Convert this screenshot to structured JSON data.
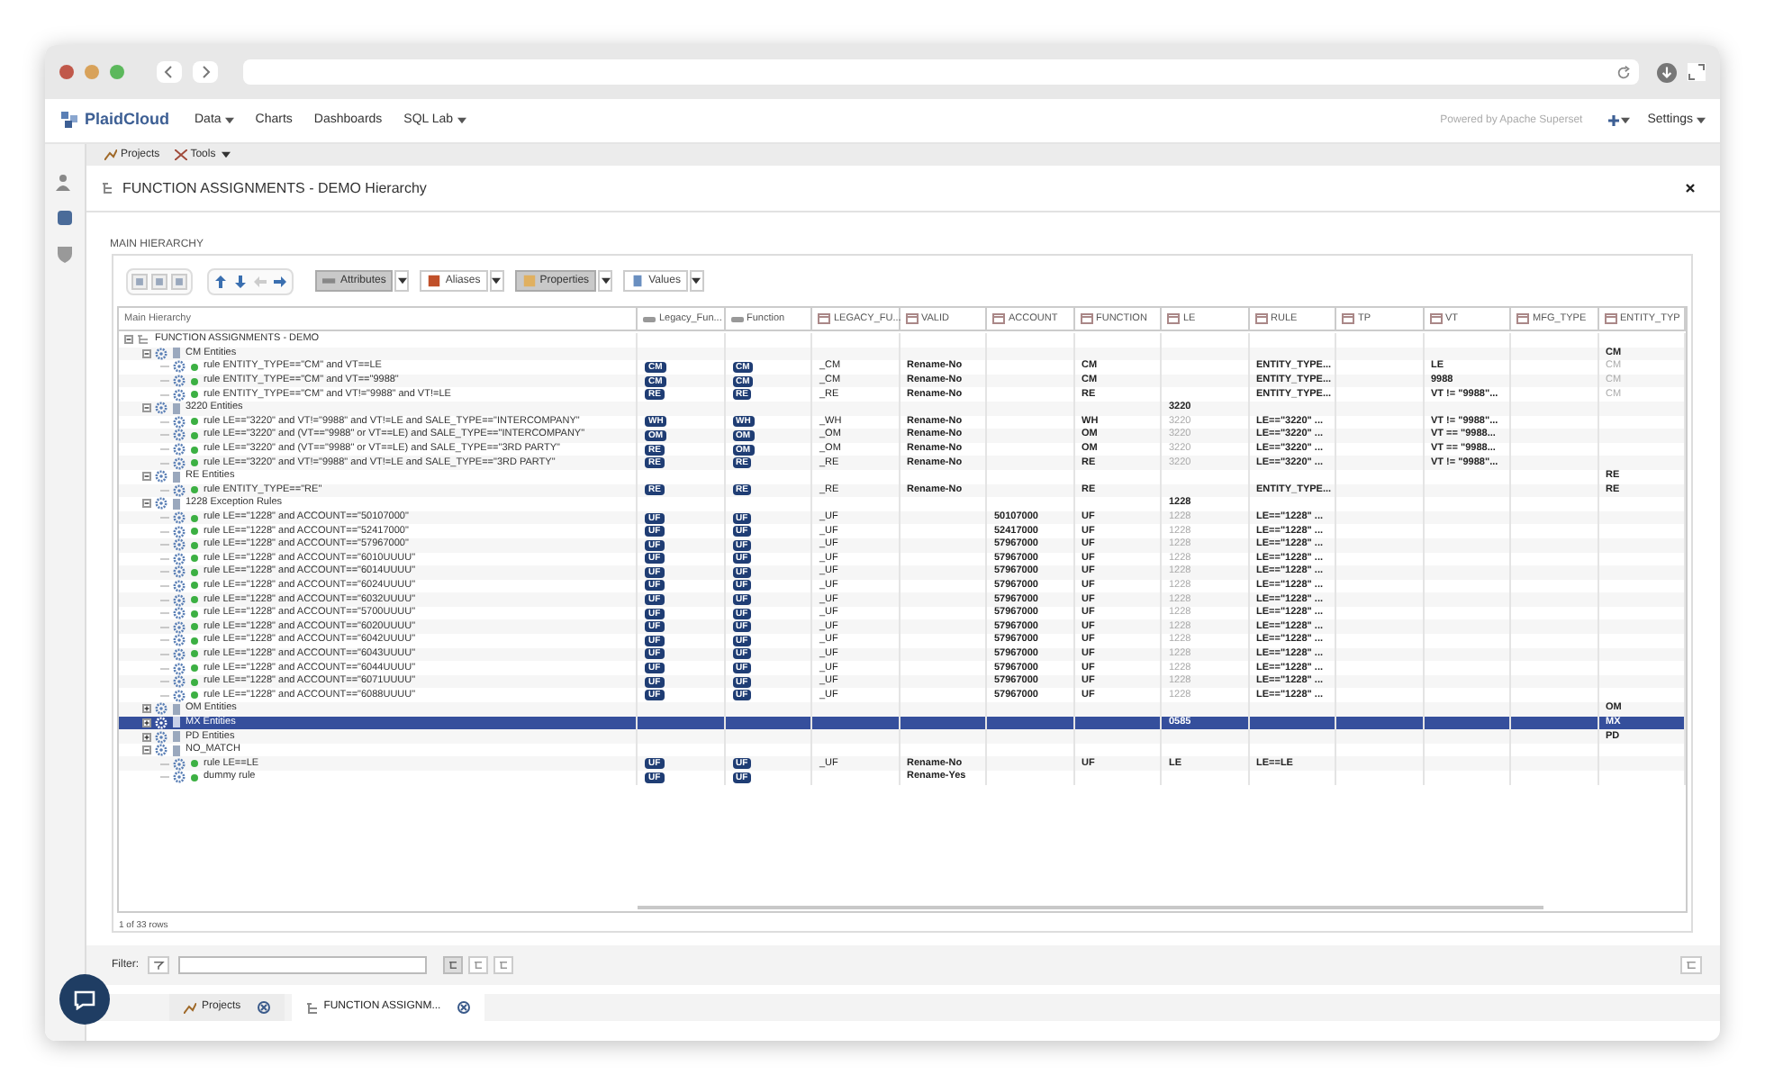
{
  "navbar": {
    "brand": "PlaidCloud",
    "menu": [
      {
        "label": "Data",
        "dropdown": true
      },
      {
        "label": "Charts",
        "dropdown": false
      },
      {
        "label": "Dashboards",
        "dropdown": false
      },
      {
        "label": "SQL Lab",
        "dropdown": true
      }
    ],
    "powered_by": "Powered by Apache Superset",
    "settings": "Settings"
  },
  "subtoolbar": [
    {
      "label": "Projects",
      "dropdown": false
    },
    {
      "label": "Tools",
      "dropdown": true
    }
  ],
  "panel": {
    "title": "FUNCTION ASSIGNMENTS - DEMO Hierarchy",
    "section": "MAIN HIERARCHY"
  },
  "toolbar": {
    "nav_buttons": [
      {
        "kind": "up",
        "disabled": false
      },
      {
        "kind": "down",
        "disabled": false
      },
      {
        "kind": "left",
        "disabled": true
      },
      {
        "kind": "right",
        "disabled": false
      }
    ],
    "view_buttons": [
      {
        "label": "Attributes",
        "selected": true
      },
      {
        "label": "Aliases",
        "selected": false
      },
      {
        "label": "Properties",
        "selected": true
      },
      {
        "label": "Values",
        "selected": false
      }
    ]
  },
  "table": {
    "tree_column": "Main Hierarchy",
    "columns": [
      {
        "label": "Legacy_Fun...",
        "kind": "badge"
      },
      {
        "label": "Function",
        "kind": "badge"
      },
      {
        "label": "LEGACY_FU...",
        "kind": "plain"
      },
      {
        "label": "VALID",
        "kind": "bold"
      },
      {
        "label": "ACCOUNT",
        "kind": "bold"
      },
      {
        "label": "FUNCTION",
        "kind": "bold"
      },
      {
        "label": "LE",
        "kind": "bold"
      },
      {
        "label": "RULE",
        "kind": "bold"
      },
      {
        "label": "TP",
        "kind": "bold"
      },
      {
        "label": "VT",
        "kind": "bold"
      },
      {
        "label": "MFG_TYPE",
        "kind": "bold"
      },
      {
        "label": "ENTITY_TYP",
        "kind": "bold"
      }
    ],
    "rows": [
      {
        "kind": "root",
        "label": "FUNCTION ASSIGNMENTS - DEMO",
        "expanded": true,
        "selected": false,
        "children": [
          {
            "kind": "group",
            "label": "CM Entities",
            "expanded": true,
            "selected": false,
            "cells": [
              null,
              null,
              null,
              null,
              null,
              null,
              null,
              null,
              null,
              null,
              null,
              "CM"
            ],
            "children": [
              {
                "kind": "rule",
                "label": "rule ENTITY_TYPE==\"CM\" and VT==LE",
                "selected": false,
                "cells": [
                  "CM",
                  "CM",
                  "_CM",
                  "Rename-No",
                  null,
                  "CM",
                  null,
                  "ENTITY_TYPE...",
                  null,
                  "LE",
                  null,
                  {
                    "text": "CM",
                    "inherited": true
                  }
                ]
              },
              {
                "kind": "rule",
                "label": "rule ENTITY_TYPE==\"CM\" and VT==\"9988\"",
                "selected": false,
                "cells": [
                  "CM",
                  "CM",
                  "_CM",
                  "Rename-No",
                  null,
                  "CM",
                  null,
                  "ENTITY_TYPE...",
                  null,
                  "9988",
                  null,
                  {
                    "text": "CM",
                    "inherited": true
                  }
                ]
              },
              {
                "kind": "rule",
                "label": "rule ENTITY_TYPE==\"CM\" and VT!=\"9988\" and VT!=LE",
                "selected": false,
                "cells": [
                  "RE",
                  "RE",
                  "_RE",
                  "Rename-No",
                  null,
                  "RE",
                  null,
                  "ENTITY_TYPE...",
                  null,
                  "VT != \"9988\"...",
                  null,
                  {
                    "text": "CM",
                    "inherited": true
                  }
                ]
              }
            ]
          },
          {
            "kind": "group",
            "label": "3220 Entities",
            "expanded": true,
            "selected": false,
            "cells": [
              null,
              null,
              null,
              null,
              null,
              null,
              "3220"
            ],
            "children": [
              {
                "kind": "rule",
                "label": "rule LE==\"3220\" and VT!=\"9988\" and VT!=LE and SALE_TYPE==\"INTERCOMPANY\"",
                "selected": false,
                "cells": [
                  "WH",
                  "WH",
                  "_WH",
                  "Rename-No",
                  null,
                  "WH",
                  {
                    "text": "3220",
                    "inherited": true
                  },
                  "LE==\"3220\" ...",
                  null,
                  "VT != \"9988\"..."
                ]
              },
              {
                "kind": "rule",
                "label": "rule LE==\"3220\" and (VT==\"9988\" or VT==LE) and SALE_TYPE==\"INTERCOMPANY\"",
                "selected": false,
                "cells": [
                  "OM",
                  "OM",
                  "_OM",
                  "Rename-No",
                  null,
                  "OM",
                  {
                    "text": "3220",
                    "inherited": true
                  },
                  "LE==\"3220\" ...",
                  null,
                  "VT == \"9988..."
                ]
              },
              {
                "kind": "rule",
                "label": "rule LE==\"3220\" and (VT==\"9988\" or VT==LE) and SALE_TYPE==\"3RD PARTY\"",
                "selected": false,
                "cells": [
                  "RE",
                  "OM",
                  "_OM",
                  "Rename-No",
                  null,
                  "OM",
                  {
                    "text": "3220",
                    "inherited": true
                  },
                  "LE==\"3220\" ...",
                  null,
                  "VT == \"9988..."
                ]
              },
              {
                "kind": "rule",
                "label": "rule LE==\"3220\" and VT!=\"9988\" and VT!=LE and SALE_TYPE==\"3RD PARTY\"",
                "selected": false,
                "cells": [
                  "RE",
                  "RE",
                  "_RE",
                  "Rename-No",
                  null,
                  "RE",
                  {
                    "text": "3220",
                    "inherited": true
                  },
                  "LE==\"3220\" ...",
                  null,
                  "VT != \"9988\"..."
                ]
              }
            ]
          },
          {
            "kind": "group",
            "label": "RE Entities",
            "expanded": true,
            "selected": false,
            "cells": [
              null,
              null,
              null,
              null,
              null,
              null,
              null,
              null,
              null,
              null,
              null,
              "RE"
            ],
            "children": [
              {
                "kind": "rule",
                "label": "rule ENTITY_TYPE==\"RE\"",
                "selected": false,
                "cells": [
                  "RE",
                  "RE",
                  "_RE",
                  "Rename-No",
                  null,
                  "RE",
                  null,
                  "ENTITY_TYPE...",
                  null,
                  null,
                  null,
                  "RE"
                ]
              }
            ]
          },
          {
            "kind": "group",
            "label": "1228 Exception Rules",
            "expanded": true,
            "selected": false,
            "cells": [
              null,
              null,
              null,
              null,
              null,
              null,
              "1228"
            ],
            "children": [
              {
                "kind": "rule",
                "label": "rule LE==\"1228\" and ACCOUNT==\"50107000\"",
                "selected": false,
                "cells": [
                  "UF",
                  "UF",
                  "_UF",
                  null,
                  "50107000",
                  "UF",
                  {
                    "text": "1228",
                    "inherited": true
                  },
                  "LE==\"1228\" ..."
                ]
              },
              {
                "kind": "rule",
                "label": "rule LE==\"1228\" and ACCOUNT==\"52417000\"",
                "selected": false,
                "cells": [
                  "UF",
                  "UF",
                  "_UF",
                  null,
                  "52417000",
                  "UF",
                  {
                    "text": "1228",
                    "inherited": true
                  },
                  "LE==\"1228\" ..."
                ]
              },
              {
                "kind": "rule",
                "label": "rule LE==\"1228\" and ACCOUNT==\"57967000\"",
                "selected": false,
                "cells": [
                  "UF",
                  "UF",
                  "_UF",
                  null,
                  "57967000",
                  "UF",
                  {
                    "text": "1228",
                    "inherited": true
                  },
                  "LE==\"1228\" ..."
                ]
              },
              {
                "kind": "rule",
                "label": "rule LE==\"1228\" and ACCOUNT==\"6010UUUU\"",
                "selected": false,
                "cells": [
                  "UF",
                  "UF",
                  "_UF",
                  null,
                  "57967000",
                  "UF",
                  {
                    "text": "1228",
                    "inherited": true
                  },
                  "LE==\"1228\" ..."
                ]
              },
              {
                "kind": "rule",
                "label": "rule LE==\"1228\" and ACCOUNT==\"6014UUUU\"",
                "selected": false,
                "cells": [
                  "UF",
                  "UF",
                  "_UF",
                  null,
                  "57967000",
                  "UF",
                  {
                    "text": "1228",
                    "inherited": true
                  },
                  "LE==\"1228\" ..."
                ]
              },
              {
                "kind": "rule",
                "label": "rule LE==\"1228\" and ACCOUNT==\"6024UUUU\"",
                "selected": false,
                "cells": [
                  "UF",
                  "UF",
                  "_UF",
                  null,
                  "57967000",
                  "UF",
                  {
                    "text": "1228",
                    "inherited": true
                  },
                  "LE==\"1228\" ..."
                ]
              },
              {
                "kind": "rule",
                "label": "rule LE==\"1228\" and ACCOUNT==\"6032UUUU\"",
                "selected": false,
                "cells": [
                  "UF",
                  "UF",
                  "_UF",
                  null,
                  "57967000",
                  "UF",
                  {
                    "text": "1228",
                    "inherited": true
                  },
                  "LE==\"1228\" ..."
                ]
              },
              {
                "kind": "rule",
                "label": "rule LE==\"1228\" and ACCOUNT==\"5700UUUU\"",
                "selected": false,
                "cells": [
                  "UF",
                  "UF",
                  "_UF",
                  null,
                  "57967000",
                  "UF",
                  {
                    "text": "1228",
                    "inherited": true
                  },
                  "LE==\"1228\" ..."
                ]
              },
              {
                "kind": "rule",
                "label": "rule LE==\"1228\" and ACCOUNT==\"6020UUUU\"",
                "selected": false,
                "cells": [
                  "UF",
                  "UF",
                  "_UF",
                  null,
                  "57967000",
                  "UF",
                  {
                    "text": "1228",
                    "inherited": true
                  },
                  "LE==\"1228\" ..."
                ]
              },
              {
                "kind": "rule",
                "label": "rule LE==\"1228\" and ACCOUNT==\"6042UUUU\"",
                "selected": false,
                "cells": [
                  "UF",
                  "UF",
                  "_UF",
                  null,
                  "57967000",
                  "UF",
                  {
                    "text": "1228",
                    "inherited": true
                  },
                  "LE==\"1228\" ..."
                ]
              },
              {
                "kind": "rule",
                "label": "rule LE==\"1228\" and ACCOUNT==\"6043UUUU\"",
                "selected": false,
                "cells": [
                  "UF",
                  "UF",
                  "_UF",
                  null,
                  "57967000",
                  "UF",
                  {
                    "text": "1228",
                    "inherited": true
                  },
                  "LE==\"1228\" ..."
                ]
              },
              {
                "kind": "rule",
                "label": "rule LE==\"1228\" and ACCOUNT==\"6044UUUU\"",
                "selected": false,
                "cells": [
                  "UF",
                  "UF",
                  "_UF",
                  null,
                  "57967000",
                  "UF",
                  {
                    "text": "1228",
                    "inherited": true
                  },
                  "LE==\"1228\" ..."
                ]
              },
              {
                "kind": "rule",
                "label": "rule LE==\"1228\" and ACCOUNT==\"6071UUUU\"",
                "selected": false,
                "cells": [
                  "UF",
                  "UF",
                  "_UF",
                  null,
                  "57967000",
                  "UF",
                  {
                    "text": "1228",
                    "inherited": true
                  },
                  "LE==\"1228\" ..."
                ]
              },
              {
                "kind": "rule",
                "label": "rule LE==\"1228\" and ACCOUNT==\"6088UUUU\"",
                "selected": false,
                "cells": [
                  "UF",
                  "UF",
                  "_UF",
                  null,
                  "57967000",
                  "UF",
                  {
                    "text": "1228",
                    "inherited": true
                  },
                  "LE==\"1228\" ..."
                ]
              }
            ]
          },
          {
            "kind": "group",
            "label": "OM Entities",
            "expanded": false,
            "selected": false,
            "cells": [
              null,
              null,
              null,
              null,
              null,
              null,
              null,
              null,
              null,
              null,
              null,
              "OM"
            ]
          },
          {
            "kind": "group",
            "label": "MX Entities",
            "expanded": false,
            "selected": true,
            "cells": [
              null,
              null,
              null,
              null,
              null,
              null,
              "0585",
              null,
              null,
              null,
              null,
              "MX"
            ]
          },
          {
            "kind": "group",
            "label": "PD Entities",
            "expanded": false,
            "selected": false,
            "cells": [
              null,
              null,
              null,
              null,
              null,
              null,
              null,
              null,
              null,
              null,
              null,
              "PD"
            ]
          },
          {
            "kind": "group",
            "label": "NO_MATCH",
            "expanded": true,
            "selected": false,
            "children": [
              {
                "kind": "rule",
                "label": "rule LE==LE",
                "selected": false,
                "cells": [
                  "UF",
                  "UF",
                  "_UF",
                  "Rename-No",
                  null,
                  "UF",
                  "LE",
                  "LE==LE"
                ]
              },
              {
                "kind": "rule",
                "label": "dummy rule",
                "selected": false,
                "cells": [
                  "UF",
                  "UF",
                  null,
                  "Rename-Yes"
                ]
              }
            ]
          }
        ]
      }
    ],
    "footer": "1 of 33 rows"
  },
  "filter": {
    "label": "Filter:"
  },
  "taskbar": [
    {
      "label": "Projects",
      "selected": false
    },
    {
      "label": "FUNCTION ASSIGNM...",
      "selected": true
    }
  ]
}
